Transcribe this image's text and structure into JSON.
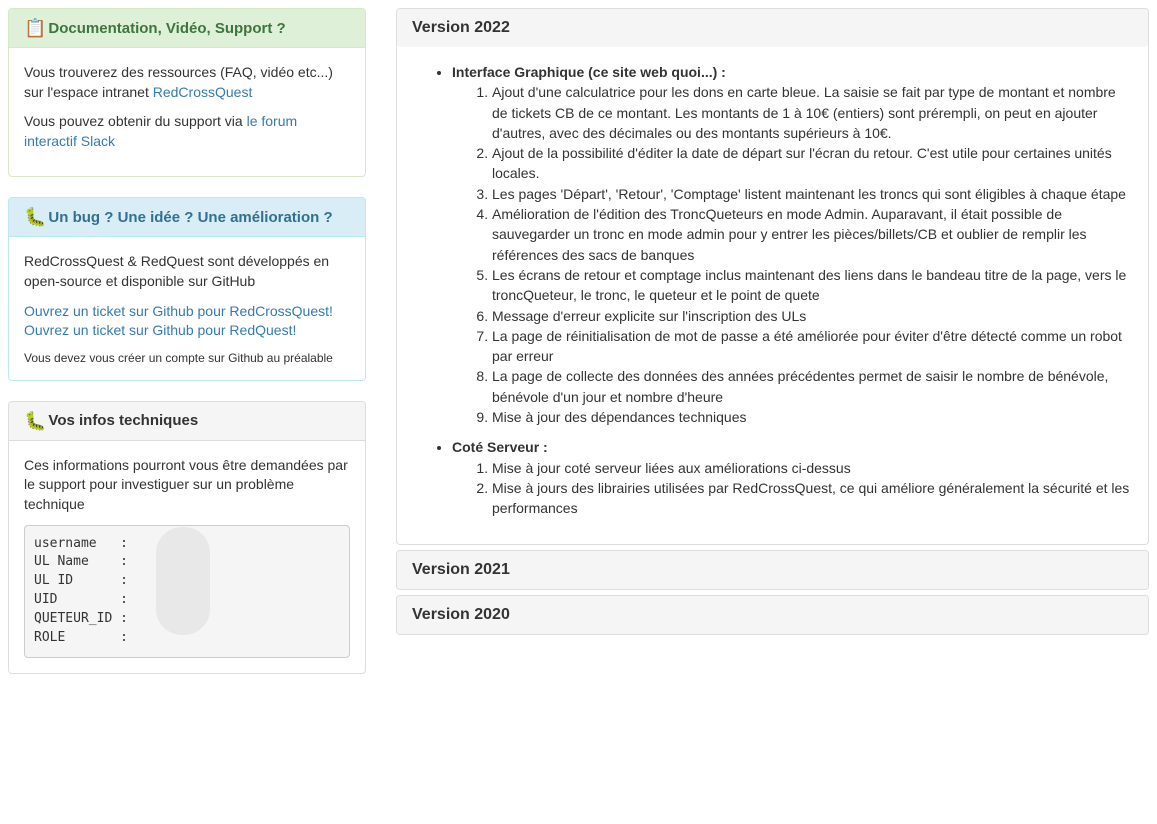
{
  "sidebar": {
    "doc_panel": {
      "title": "Documentation, Vidéo, Support ?",
      "intro_text": "Vous trouverez des ressources (FAQ, vidéo etc...) sur l'espace intranet ",
      "intranet_link": "RedCrossQuest",
      "support_text": "Vous pouvez obtenir du support via ",
      "slack_link": "le forum interactif Slack"
    },
    "bug_panel": {
      "title": "Un bug ? Une idée ? Une amélioration ?",
      "intro_text": "RedCrossQuest & RedQuest sont développés en open-source et disponible sur GitHub",
      "ticket_rcq_link": "Ouvrez un ticket sur Github pour RedCrossQuest!",
      "ticket_rq_link": "Ouvrez un ticket sur Github pour RedQuest!",
      "github_note": "Vous devez vous créer un compte sur Github au préalable"
    },
    "tech_panel": {
      "title": "Vos infos techniques",
      "intro_text": "Ces informations pourront vous être demandées par le support pour investiguer sur un problème technique",
      "fields": {
        "username_label": "username   :",
        "ulname_label": "UL Name    :",
        "ulid_label": "UL ID      :",
        "uid_label": "UID        :",
        "queteur_label": "QUETEUR_ID :",
        "role_label": "ROLE       :"
      }
    }
  },
  "versions": {
    "v2022": {
      "title": "Version 2022",
      "ui_heading": "Interface Graphique (ce site web quoi...) :",
      "ui_items": [
        "Ajout d'une calculatrice pour les dons en carte bleue. La saisie se fait par type de montant et nombre de tickets CB de ce montant. Les montants de 1 à 10€ (entiers) sont prérempli, on peut en ajouter d'autres, avec des décimales ou des montants supérieurs à 10€.",
        "Ajout de la possibilité d'éditer la date de départ sur l'écran du retour. C'est utile pour certaines unités locales.",
        "Les pages 'Départ', 'Retour', 'Comptage' listent maintenant les troncs qui sont éligibles à chaque étape",
        "Amélioration de l'édition des TroncQueteurs en mode Admin. Auparavant, il était possible de sauvegarder un tronc en mode admin pour y entrer les pièces/billets/CB et oublier de remplir les références des sacs de banques",
        "Les écrans de retour et comptage inclus maintenant des liens dans le bandeau titre de la page, vers le troncQueteur, le tronc, le queteur et le point de quete",
        "Message d'erreur explicite sur l'inscription des ULs",
        "La page de réinitialisation de mot de passe a été améliorée pour éviter d'être détecté comme un robot par erreur",
        "La page de collecte des données des années précédentes permet de saisir le nombre de bénévole, bénévole d'un jour et nombre d'heure",
        "Mise à jour des dépendances techniques"
      ],
      "server_heading": "Coté Serveur :",
      "server_items": [
        "Mise à jour coté serveur liées aux améliorations ci-dessus",
        "Mise à jours des librairies utilisées par RedCrossQuest, ce qui améliore généralement la sécurité et les performances"
      ]
    },
    "v2021": {
      "title": "Version 2021"
    },
    "v2020": {
      "title": "Version 2020"
    }
  }
}
